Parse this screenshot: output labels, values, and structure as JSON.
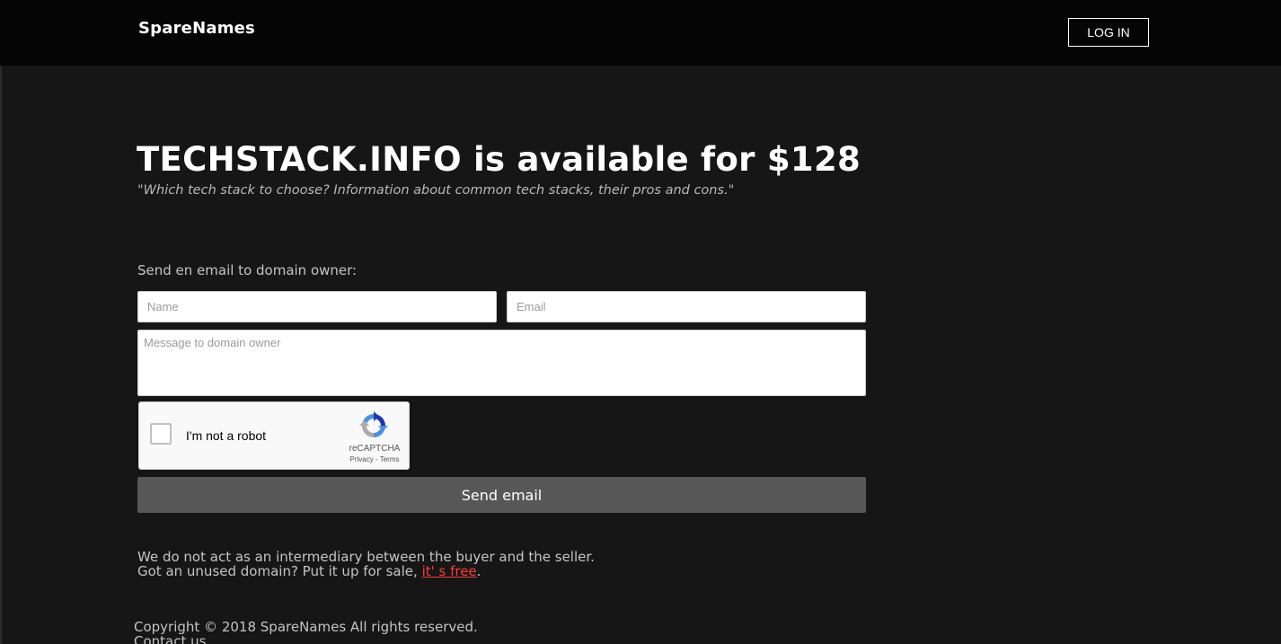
{
  "header": {
    "logo": "SpareNames",
    "login_label": "LOG IN"
  },
  "hero": {
    "headline": "TECHSTACK.INFO is available for $128",
    "tagline": "\"Which tech stack to choose? Information about common tech stacks, their pros and cons.\""
  },
  "form": {
    "label": "Send en email to domain owner:",
    "name_placeholder": "Name",
    "email_placeholder": "Email",
    "message_placeholder": "Message to domain owner",
    "send_label": "Send email"
  },
  "recaptcha": {
    "label": "I'm not a robot",
    "brand": "reCAPTCHA",
    "privacy": "Privacy",
    "separator": " - ",
    "terms": "Terms",
    "icon": "recaptcha-logo-icon"
  },
  "disclaimer": {
    "line1": "We do not act as an intermediary between the buyer and the seller.",
    "line2_prefix": "Got an unused domain? Put it up for sale, ",
    "line2_link": "it' s free",
    "line2_suffix": "."
  },
  "footer": {
    "copyright": "Copyright © 2018 SpareNames All rights reserved.",
    "contact": "Contact us"
  },
  "colors": {
    "page_background": "#161616",
    "header_background": "#050505",
    "button_background": "#575757",
    "link_color": "#ff3b30"
  }
}
